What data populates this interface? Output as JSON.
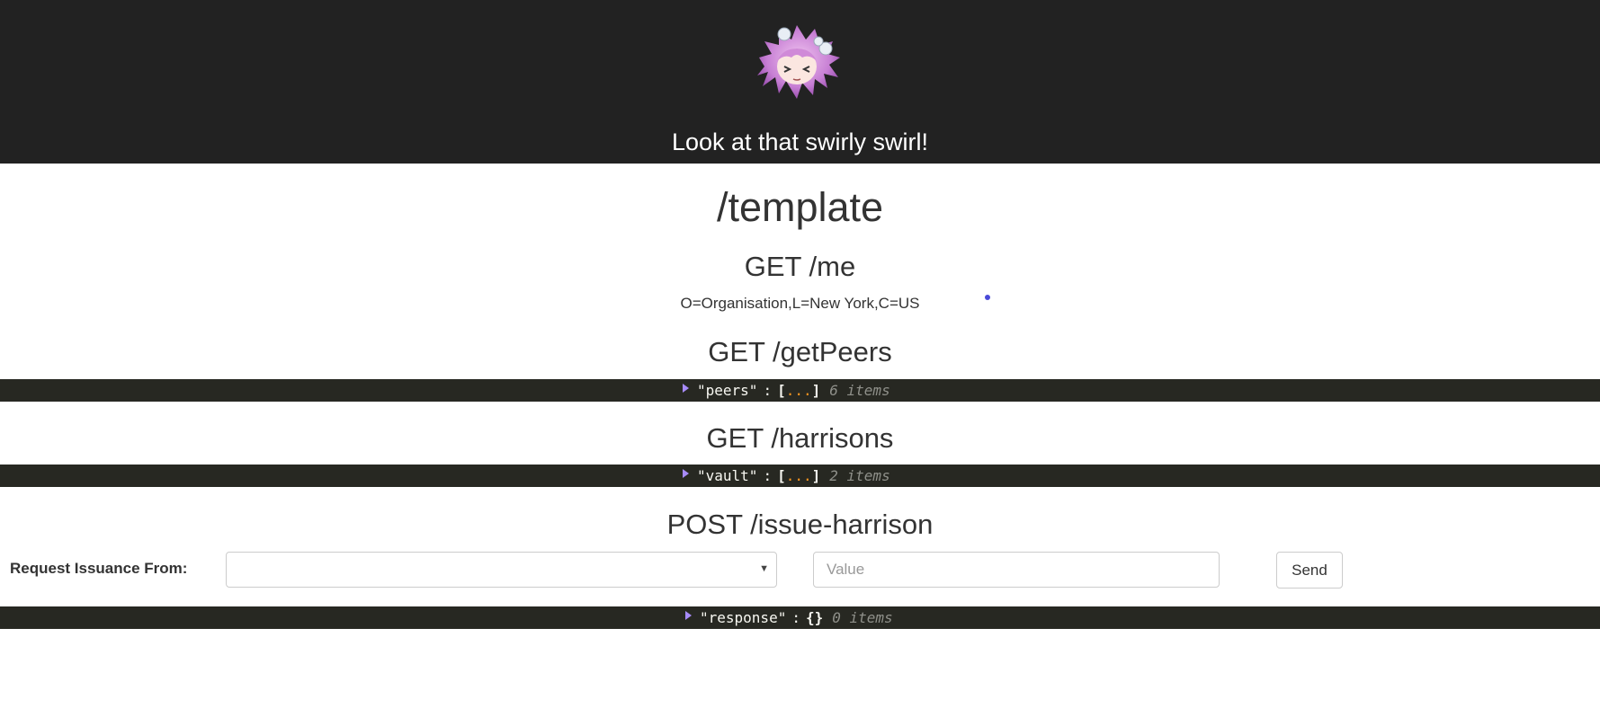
{
  "header": {
    "logo_icon": "anime-girl-logo",
    "tagline": "Look at that swirly swirl!"
  },
  "page": {
    "title": "/template"
  },
  "sections": {
    "me": {
      "title": "GET /me",
      "value": "O=Organisation,L=New York,C=US"
    },
    "peers": {
      "title": "GET /getPeers",
      "json_key": "\"peers\"",
      "colon": ":",
      "open": "[",
      "ellipsis": "...",
      "close": "]",
      "count": "6 items"
    },
    "harrisons": {
      "title": "GET /harrisons",
      "json_key": "\"vault\"",
      "colon": ":",
      "open": "[",
      "ellipsis": "...",
      "close": "]",
      "count": "2 items"
    },
    "issue": {
      "title": "POST /issue-harrison",
      "label": "Request Issuance From:",
      "select_value": "",
      "value_placeholder": "Value",
      "value_text": "",
      "send_label": "Send",
      "json_key": "\"response\"",
      "colon": ":",
      "braces": "{}",
      "count": "0 items"
    }
  },
  "colors": {
    "header_bg": "#222222",
    "json_bg": "#272822",
    "caret": "#a78bfa",
    "ellipsis": "#fd971f",
    "dot": "#4a4ad8"
  }
}
